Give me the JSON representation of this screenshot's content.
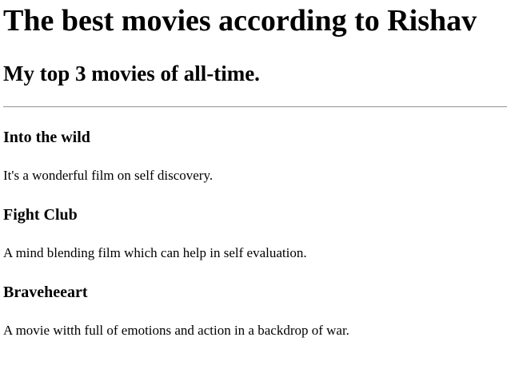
{
  "page": {
    "heading": "The best movies according to Rishav",
    "subheading": "My top 3 movies of all-time."
  },
  "movies": [
    {
      "title": "Into the wild",
      "description": "It's a wonderful film on self discovery."
    },
    {
      "title": "Fight Club",
      "description": "A mind blending film which can help in self evaluation."
    },
    {
      "title": "Braveheeart",
      "description": "A movie witth full of emotions and action in a backdrop of war."
    }
  ]
}
